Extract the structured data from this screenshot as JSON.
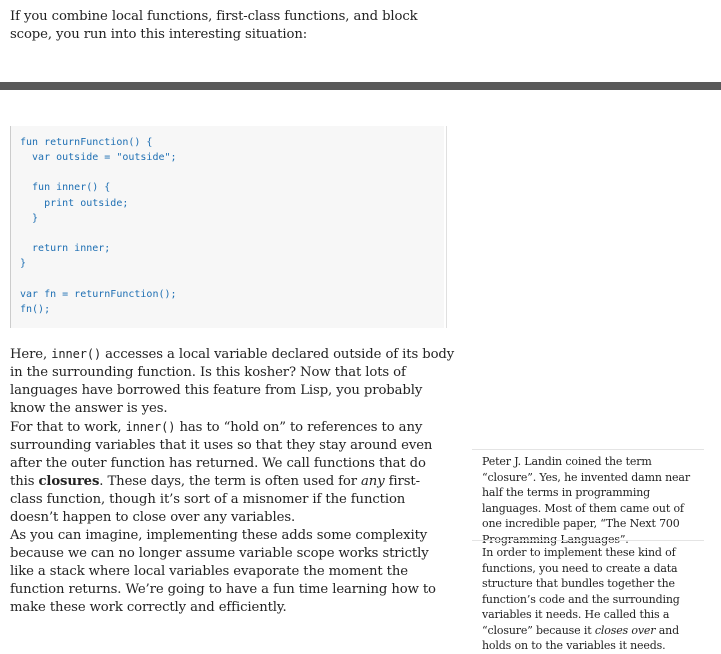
{
  "intro": "If you combine local functions, first-class functions, and block scope, you run into this interesting situation:",
  "code": {
    "lines": [
      "fun returnFunction() {",
      "  var outside = \"outside\";",
      "",
      "  fun inner() {",
      "    print outside;",
      "  }",
      "",
      "  return inner;",
      "}",
      "",
      "var fn = returnFunction();",
      "fn();"
    ]
  },
  "paragraph1": {
    "before": "Here, ",
    "code": "inner()",
    "after": " accesses a local variable declared outside of its body in the surrounding function. Is this kosher? Now that lots of languages have borrowed this feature from Lisp, you probably know the answer is yes."
  },
  "paragraph2": {
    "before": "For that to work, ",
    "code": "inner()",
    "middle": " has to “hold on” to references to any surrounding variables that it uses so that they stay around even after the outer function has returned. We call functions that do this ",
    "bold": "closures",
    "middle2": ". These days, the term is often used for ",
    "italic": "any",
    "after": " first-class function, though it’s sort of a misnomer if the function doesn’t happen to close over any variables."
  },
  "paragraph3": "As you can imagine, implementing these adds some complexity because we can no longer assume variable scope works strictly like a stack where local variables evaporate the moment the function returns. We’re going to have a fun time learning how to make these work correctly and efficiently.",
  "aside1": "Peter J. Landin coined the term “closure”. Yes, he invented damn near half the terms in programming languages. Most of them came out of one incredible paper, “The Next 700 Programming Languages”.",
  "aside2": {
    "before": "In order to implement these kind of functions, you need to create a data structure that bundles together the function’s code and the surrounding variables it needs. He called this a “closure” because it ",
    "italic": "closes over",
    "after": " and holds on to the variables it needs."
  }
}
